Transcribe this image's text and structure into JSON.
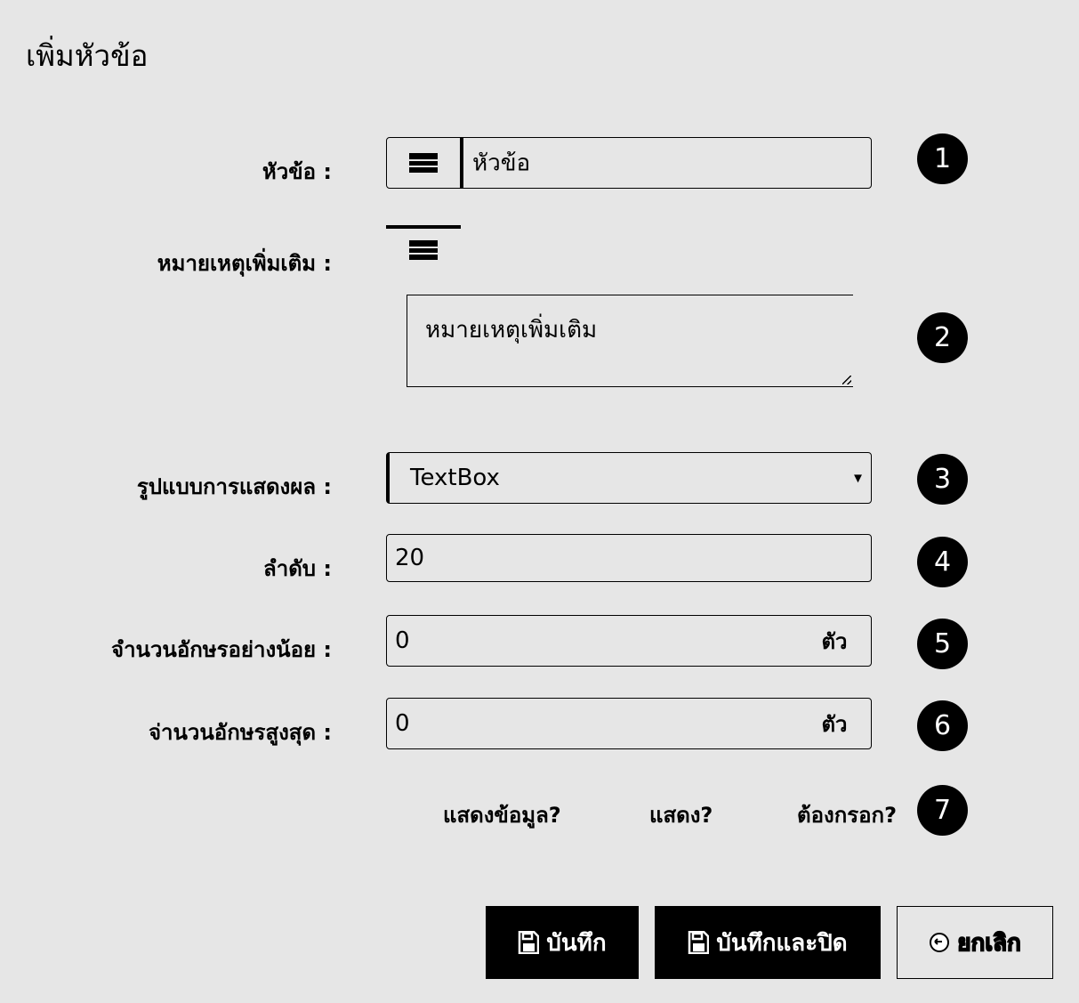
{
  "dialog": {
    "title": "เพิ่มหัวข้อ"
  },
  "form": {
    "topic": {
      "label": "หัวข้อ :",
      "value": "หัวข้อ",
      "icon": "card-icon"
    },
    "remark": {
      "label": "หมายเหตุเพิ่มเติม :",
      "value": "หมายเหตุเพิ่มเติม",
      "icon": "card-icon"
    },
    "display_type": {
      "label": "รูปแบบการแสดงผล :",
      "selected": "TextBox",
      "arrow": "▾"
    },
    "order": {
      "label": "ลำดับ :",
      "value": "20"
    },
    "min_chars": {
      "label": "จำนวนอักษรอย่างน้อย :",
      "value": "0",
      "unit": "ตัว"
    },
    "max_chars": {
      "label": "จ่านวนอักษรสูงสุด :",
      "value": "0",
      "unit": "ตัว"
    },
    "options": {
      "show_data": "แสดงข้อมูล?",
      "show": "แสดง?",
      "required": "ต้องกรอก?"
    }
  },
  "badges": [
    "1",
    "2",
    "3",
    "4",
    "5",
    "6",
    "7"
  ],
  "buttons": {
    "save": "บันทึก",
    "save_close": "บันทึกและปิด",
    "cancel": "ยกเลิก"
  }
}
